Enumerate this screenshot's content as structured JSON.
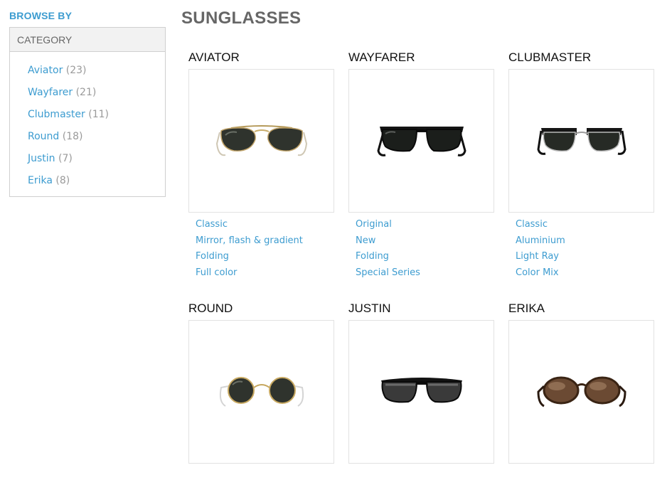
{
  "sidebar": {
    "heading": "BROWSE BY",
    "category_header": "CATEGORY",
    "items": [
      {
        "label": "Aviator",
        "count": "(23)"
      },
      {
        "label": "Wayfarer",
        "count": "(21)"
      },
      {
        "label": "Clubmaster",
        "count": "(11)"
      },
      {
        "label": "Round",
        "count": "(18)"
      },
      {
        "label": "Justin",
        "count": "(7)"
      },
      {
        "label": "Erika",
        "count": "(8)"
      }
    ]
  },
  "main": {
    "title": "SUNGLASSES",
    "products": [
      {
        "name": "AVIATOR",
        "image": "aviator-sunglasses-image",
        "links": [
          "Classic",
          "Mirror, flash & gradient",
          "Folding",
          "Full color"
        ]
      },
      {
        "name": "WAYFARER",
        "image": "wayfarer-sunglasses-image",
        "links": [
          "Original",
          "New",
          "Folding",
          "Special Series"
        ]
      },
      {
        "name": "CLUBMASTER",
        "image": "clubmaster-sunglasses-image",
        "links": [
          "Classic",
          "Aluminium",
          "Light Ray",
          "Color Mix"
        ]
      },
      {
        "name": "ROUND",
        "image": "round-sunglasses-image",
        "links": []
      },
      {
        "name": "JUSTIN",
        "image": "justin-sunglasses-image",
        "links": []
      },
      {
        "name": "ERIKA",
        "image": "erika-sunglasses-image",
        "links": []
      }
    ]
  },
  "colors": {
    "accent": "#3d9cd0",
    "title_gray": "#666666",
    "count_gray": "#9a9a9a",
    "border": "#cfcfcf"
  }
}
